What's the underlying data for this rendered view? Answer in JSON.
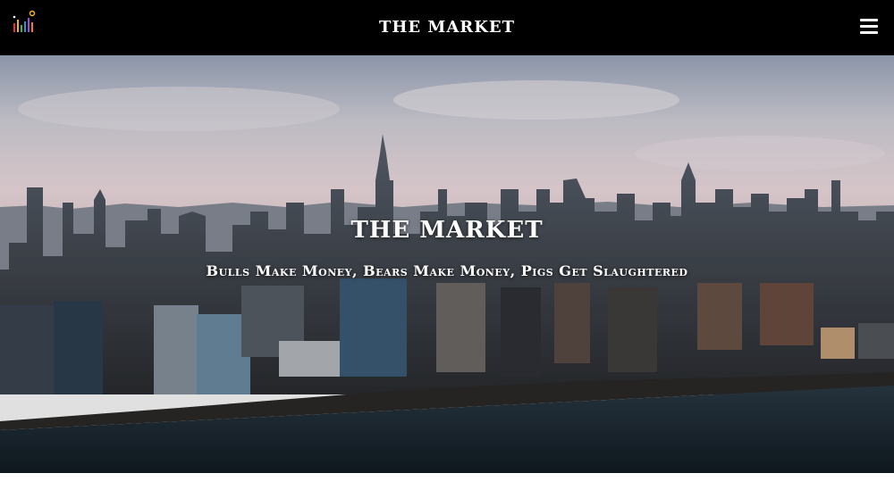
{
  "navbar": {
    "brand": "THE MARKET",
    "logo_icon": "bar-chart-logo-icon",
    "menu_icon": "hamburger-menu-icon",
    "background": "#000000"
  },
  "hero": {
    "title": "THE MARKET",
    "tagline": "Bulls Make Money, Bears Make Money, Pigs Get Slaughtered",
    "image_description_icon": "city-skyline-image"
  },
  "colors": {
    "logo_bars": [
      "#e0352b",
      "#f5b800",
      "#3fb549",
      "#2f8fdc",
      "#9b4fd0",
      "#f07b1a"
    ],
    "sky_top": "#a9b4c8",
    "sky_horizon": "#f2dde2",
    "water": "#1d2d3a"
  }
}
